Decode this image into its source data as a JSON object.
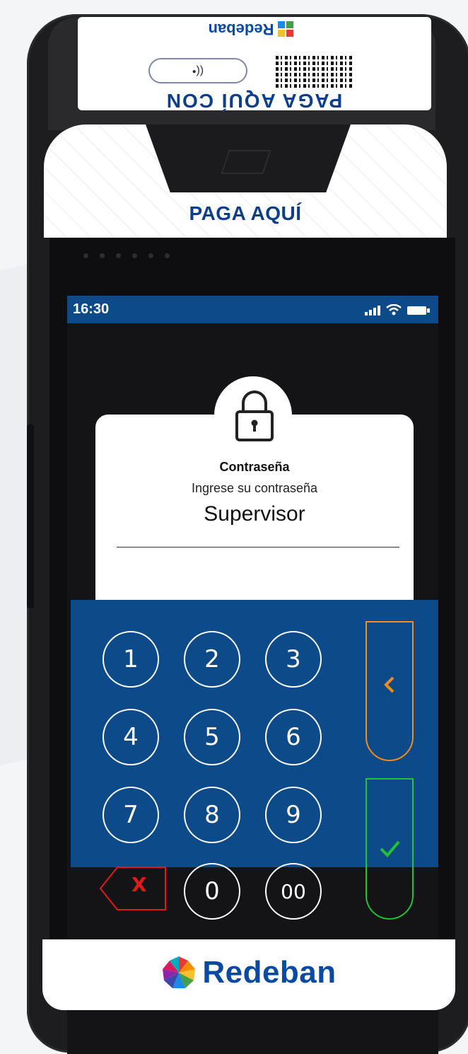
{
  "device": {
    "top_label": "PAGA AQUÍ CON",
    "top_brand": "Redeban",
    "contactless_symbol": "((•",
    "front_text": "PAGA AQUÍ",
    "bottom_brand": "Redeban"
  },
  "status_bar": {
    "time": "16:30",
    "icons": [
      "signal-icon",
      "wifi-icon",
      "battery-icon"
    ]
  },
  "dialog": {
    "icon": "lock-icon",
    "title": "Contraseña",
    "subtitle": "Ingrese su contraseña",
    "value": "Supervisor"
  },
  "keypad": {
    "keys": [
      "1",
      "2",
      "3",
      "4",
      "5",
      "6",
      "7",
      "8",
      "9",
      "0",
      "00"
    ],
    "clear_label": "X",
    "back_icon": "chevron-left-icon",
    "confirm_icon": "checkmark-icon"
  },
  "colors": {
    "brand_blue": "#0c4a8a",
    "back_orange": "#f28c1a",
    "confirm_green": "#22c232",
    "clear_red": "#e01a1a"
  }
}
